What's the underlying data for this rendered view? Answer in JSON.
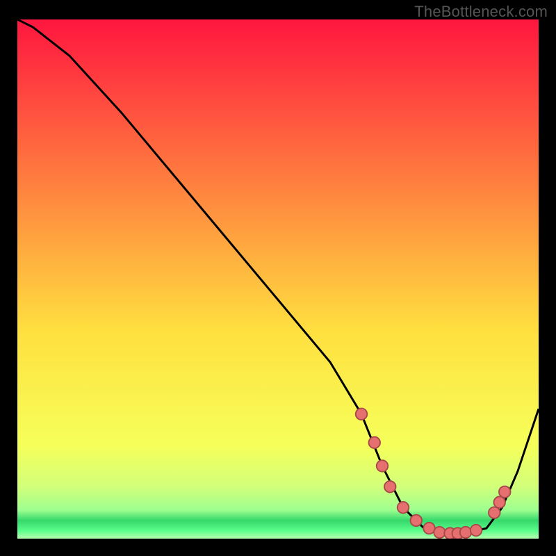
{
  "attribution": "TheBottleneck.com",
  "colors": {
    "bg": "#000000",
    "gradient_top": "#ff163f",
    "gradient_mid_upper": "#ff7a3f",
    "gradient_mid": "#ffe03f",
    "gradient_mid_lower": "#f6ff5a",
    "gradient_green": "#35d86a",
    "curve": "#000000",
    "marker_fill": "#e67070",
    "marker_stroke": "#a84848"
  },
  "chart_data": {
    "type": "line",
    "title": "",
    "xlabel": "",
    "ylabel": "",
    "xlim": [
      0,
      100
    ],
    "ylim": [
      0,
      100
    ],
    "curve": {
      "name": "bottleneck-curve",
      "x": [
        0,
        3,
        10,
        20,
        30,
        40,
        50,
        60,
        66,
        70,
        74,
        78,
        82,
        86,
        90,
        93,
        96,
        100
      ],
      "y": [
        100,
        98.5,
        93,
        82,
        70,
        58,
        46,
        34,
        24,
        14,
        6,
        2,
        1,
        1,
        2,
        6,
        13,
        25
      ]
    },
    "markers": {
      "name": "highlight-points",
      "x": [
        66,
        68.5,
        70,
        71.5,
        74,
        76.5,
        79,
        81,
        83,
        84.5,
        86,
        88,
        91.5,
        92.5,
        93.5
      ],
      "y": [
        24,
        18.5,
        14,
        10,
        6,
        3.5,
        2,
        1.2,
        1,
        1,
        1.2,
        1.6,
        5,
        7,
        9
      ]
    },
    "background_gradient_stops": [
      {
        "offset": 0.0,
        "color": "#ff163f"
      },
      {
        "offset": 0.3,
        "color": "#ff7a3f"
      },
      {
        "offset": 0.6,
        "color": "#ffe03f"
      },
      {
        "offset": 0.82,
        "color": "#f6ff5a"
      },
      {
        "offset": 0.9,
        "color": "#d2ff7a"
      },
      {
        "offset": 0.945,
        "color": "#9dff90"
      },
      {
        "offset": 0.965,
        "color": "#35d86a"
      },
      {
        "offset": 0.985,
        "color": "#5cff8c"
      },
      {
        "offset": 1.0,
        "color": "#b8ffb0"
      }
    ]
  }
}
